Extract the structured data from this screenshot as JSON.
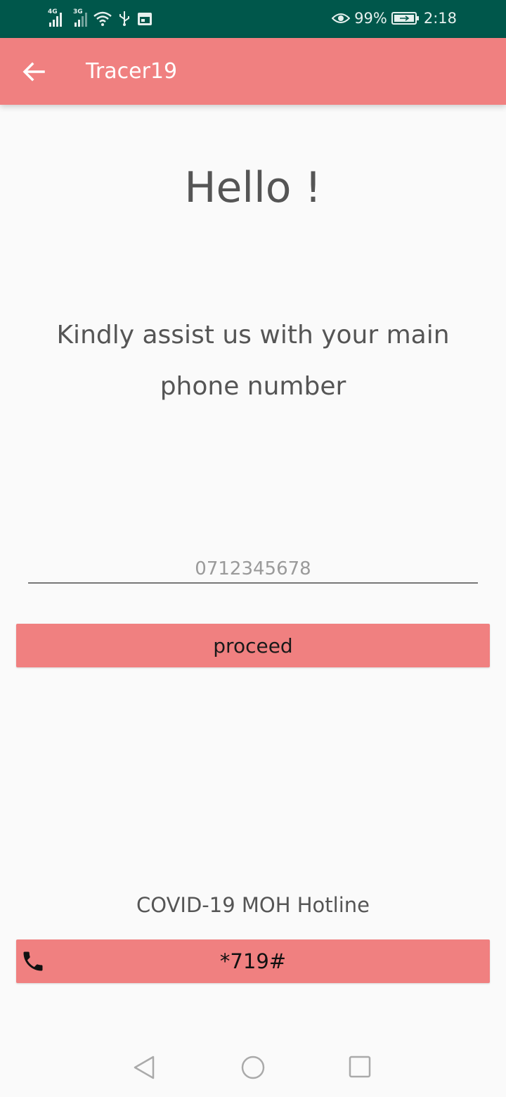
{
  "status_bar": {
    "network_1": "4G",
    "network_2": "3G",
    "battery_percent": "99%",
    "time": "2:18",
    "icons": [
      "signal-4g-icon",
      "signal-3g-icon",
      "wifi-icon",
      "usb-icon",
      "calendar-icon",
      "eye-icon",
      "battery-charging-icon"
    ]
  },
  "app_bar": {
    "title": "Tracer19",
    "back_icon": "arrow-back-icon",
    "background": "#f08080"
  },
  "main": {
    "greeting": "Hello !",
    "prompt": "Kindly assist us with your main phone number",
    "phone_input": {
      "placeholder": "0712345678",
      "value": ""
    },
    "proceed_label": "proceed"
  },
  "hotline": {
    "label": "COVID-19 MOH Hotline",
    "code": "*719#",
    "icon": "phone-icon"
  },
  "nav_bar": {
    "icons": [
      "nav-back-icon",
      "nav-home-icon",
      "nav-recents-icon"
    ]
  },
  "colors": {
    "status_bar": "#00574b",
    "accent": "#f08080",
    "text": "#555555",
    "background": "#fafafa"
  }
}
